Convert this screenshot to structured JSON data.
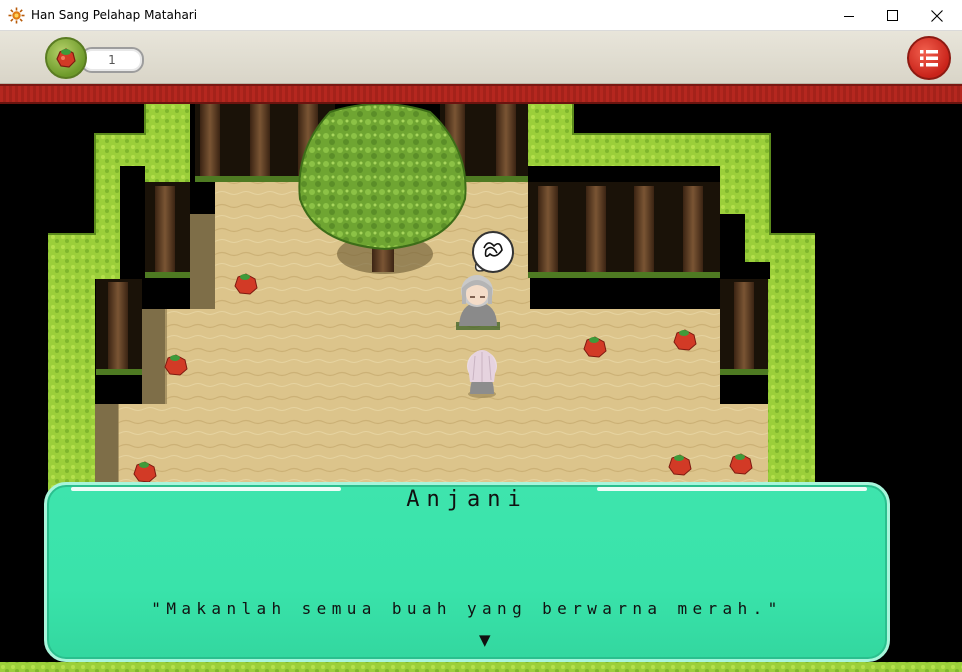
{
  "window": {
    "title": "Han Sang Pelahap Matahari",
    "icon": "sun-gear-icon",
    "controls": [
      "minimize-icon",
      "maximize-icon",
      "close-icon"
    ]
  },
  "hud": {
    "fruit_icon": "red-fruit-icon",
    "fruit_count": "1",
    "menu_icon": "list-menu-icon"
  },
  "map": {
    "ground": "sand",
    "objects": [
      "large-tree",
      "tree-trunks",
      "hedge-walls",
      "red-fruits"
    ],
    "fruit_count_visible": 7
  },
  "characters": {
    "npc_thought_icon": "scribble-thought-bubble-icon"
  },
  "dialog": {
    "speaker": "Anjani",
    "text": "\"Makanlah semua buah yang berwarna merah.\"",
    "continue_icon": "▼"
  },
  "colors": {
    "dialog_bg": "#3ee4ad",
    "rail": "#b5271f",
    "hud_bg": "#e8e5da",
    "menu_button": "#d52f22"
  }
}
